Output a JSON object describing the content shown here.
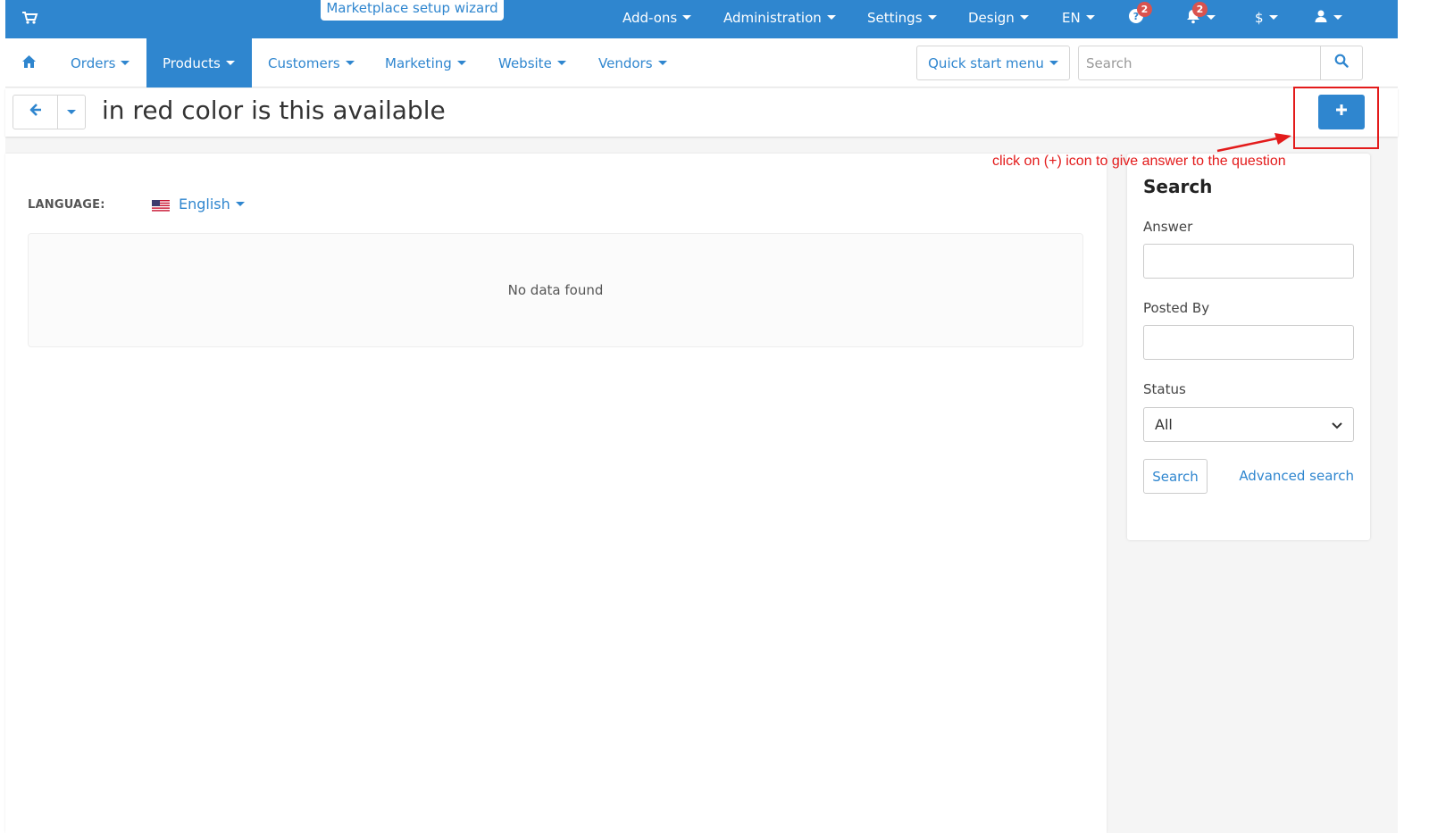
{
  "topbar": {
    "wizard_label": "Marketplace setup wizard",
    "items": {
      "addons": "Add-ons",
      "administration": "Administration",
      "settings": "Settings",
      "design": "Design",
      "language": "EN",
      "currency": "$"
    },
    "help_badge": "2",
    "notifications_badge": "2",
    "color": "#2f86cf"
  },
  "nav": {
    "items": {
      "orders": "Orders",
      "products": "Products",
      "customers": "Customers",
      "marketing": "Marketing",
      "website": "Website",
      "vendors": "Vendors"
    },
    "active": "Products",
    "quick_start": "Quick start menu",
    "search_placeholder": "Search"
  },
  "page": {
    "title": "in red color is this available"
  },
  "annotation": {
    "text": "click on (+) icon to give answer to the question",
    "color": "#e31b1b"
  },
  "main": {
    "language_label": "LANGUAGE:",
    "language_value": "English",
    "empty_text": "No data found"
  },
  "sidebar": {
    "title": "Search",
    "answer_label": "Answer",
    "posted_by_label": "Posted By",
    "status_label": "Status",
    "status_value": "All",
    "search_button": "Search",
    "advanced_search": "Advanced search"
  },
  "icons": [
    "cart-icon",
    "help-icon",
    "bell-icon",
    "user-icon",
    "home-icon",
    "search-icon",
    "arrow-left-icon",
    "caret-down-icon",
    "plus-icon",
    "us-flag-icon"
  ]
}
